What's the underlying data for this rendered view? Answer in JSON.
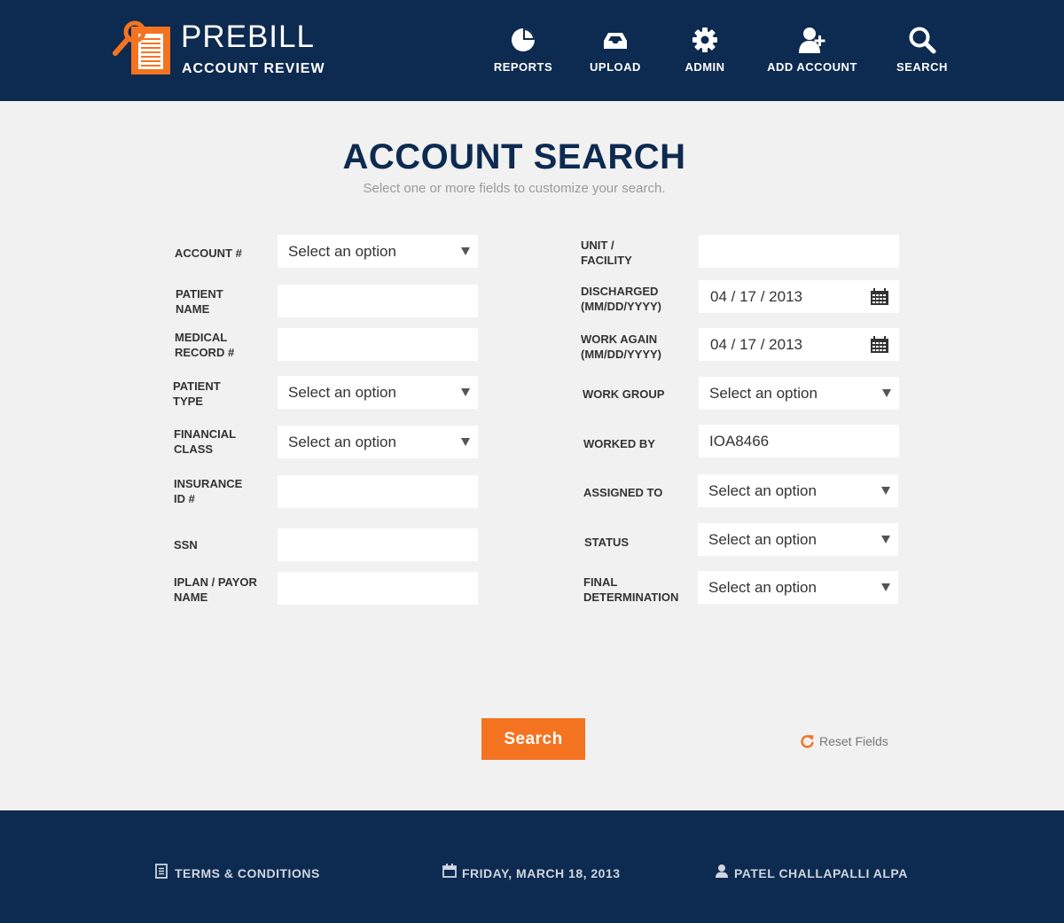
{
  "header": {
    "logo_title": "PREBILL",
    "logo_subtitle": "ACCOUNT REVIEW",
    "nav": [
      {
        "label": "REPORTS",
        "icon": "pie-chart-icon"
      },
      {
        "label": "UPLOAD",
        "icon": "inbox-tray-icon"
      },
      {
        "label": "ADMIN",
        "icon": "gear-icon"
      },
      {
        "label": "ADD ACCOUNT",
        "icon": "add-user-icon"
      },
      {
        "label": "SEARCH",
        "icon": "magnifier-icon"
      }
    ]
  },
  "main": {
    "title": "ACCOUNT SEARCH",
    "subtitle": "Select one or more fields to customize your search.",
    "left_fields": [
      {
        "label": "ACCOUNT #",
        "type": "select",
        "value": "Select an option"
      },
      {
        "label": "PATIENT NAME",
        "type": "text",
        "value": ""
      },
      {
        "label": "MEDICAL RECORD #",
        "type": "text",
        "value": ""
      },
      {
        "label": "PATIENT TYPE",
        "type": "select",
        "value": "Select an option"
      },
      {
        "label": "FINANCIAL CLASS",
        "type": "select",
        "value": "Select an option"
      },
      {
        "label": "INSURANCE ID #",
        "type": "text",
        "value": ""
      },
      {
        "label": "SSN",
        "type": "text",
        "value": ""
      },
      {
        "label": "IPLAN / PAYOR NAME",
        "type": "text",
        "value": ""
      }
    ],
    "right_fields": [
      {
        "label": "UNIT / FACILITY",
        "type": "text",
        "value": ""
      },
      {
        "label": "DISCHARGED (MM/DD/YYYY)",
        "type": "date",
        "value": "04 / 17 / 2013"
      },
      {
        "label": "WORK AGAIN (MM/DD/YYYY)",
        "type": "date",
        "value": "04 / 17 / 2013"
      },
      {
        "label": "WORK GROUP",
        "type": "select",
        "value": "Select an option"
      },
      {
        "label": "WORKED BY",
        "type": "text",
        "value": "IOA8466"
      },
      {
        "label": "ASSIGNED TO",
        "type": "select",
        "value": "Select an option"
      },
      {
        "label": "STATUS",
        "type": "select",
        "value": "Select an option"
      },
      {
        "label": "FINAL DETERMINATION",
        "type": "select",
        "value": "Select an option"
      }
    ],
    "search_button": "Search",
    "reset_label": "Reset Fields"
  },
  "footer": {
    "terms": "TERMS & CONDITIONS",
    "date": "FRIDAY, MARCH 18, 2013",
    "user": "PATEL CHALLAPALLI ALPA"
  },
  "colors": {
    "navy": "#0d2a50",
    "accent_orange": "#f47321",
    "background": "#f1f1f1"
  }
}
